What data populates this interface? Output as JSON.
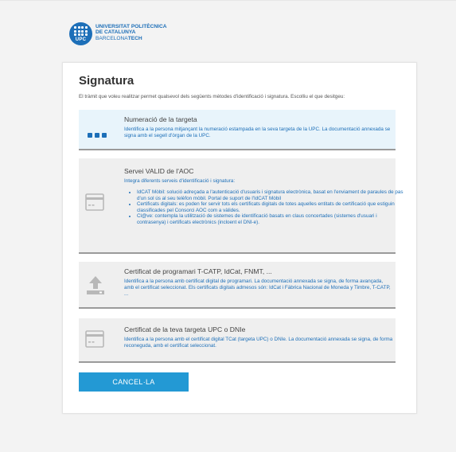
{
  "logo": {
    "line1": "UNIVERSITAT POLITÈCNICA",
    "line2": "DE CATALUNYA",
    "line3_a": "BARCELONA",
    "line3_b": "TECH",
    "mark": "UPC"
  },
  "page": {
    "title": "Signatura",
    "intro": "El tràmit que voleu realitzar permet qualsevol dels següents mètodes d'identificació i signatura. Escolliu el que desitgeu:"
  },
  "options": [
    {
      "icon": "keypad-dots-icon",
      "title": "Numeració de la targeta",
      "description": "Identifica a la persona mitjançant la numeració estampada en la seva targeta de la UPC. La documentació annexada se signa amb el segell d'òrgan de la UPC."
    },
    {
      "icon": "card-icon",
      "title": "Servei VALID de l'AOC",
      "description": "Integra diferents serveis d'identificació i signatura:",
      "bullets": [
        "IdCAT Mòbil: solució adreçada a l'autenticació d'usuaris i signatura electrònica, basat en l'enviament de paraules de pas d'un sol ús al seu telèfon mòbil. Portal de suport de l'IdCAT Mòbil",
        "Certificats digitals: es poden fer servir tots els certificats digitals de totes aquelles entitats de certificació que estiguin classificades pel Consorci AOC com a vàlides.",
        "Cl@ve: contempla la utilització de sistemes de identificació basats en claus concertades (sistemes d'usuari i contrasenya) i certificats electrònics (incloent el DNI-e)."
      ]
    },
    {
      "icon": "upload-icon",
      "title": "Certificat de programari T-CATP, IdCat, FNMT, ...",
      "description": "Identifica a la persona amb certificat digital de programari. La documentació annexada se signa, de forma avançada, amb el certificat seleccionat. Els certificats digitals admesos són: IdCat i Fàbrica Nacional de Moneda y Timbre, T-CATP, ..."
    },
    {
      "icon": "card-icon",
      "title": "Certificat de la teva targeta UPC o DNIe",
      "description": "Identifica a la persona amb el certificat digital TCat (targeta UPC) o DNIe. La documentació annexada se signa, de forma reconeguda, amb el certificat seleccionat."
    }
  ],
  "actions": {
    "cancel_label": "CANCEL·LA"
  },
  "colors": {
    "brand_blue": "#1d6fb8",
    "button_blue": "#2399d4",
    "option_selected_bg": "#e8f4fb",
    "option_bg": "#efefef"
  }
}
